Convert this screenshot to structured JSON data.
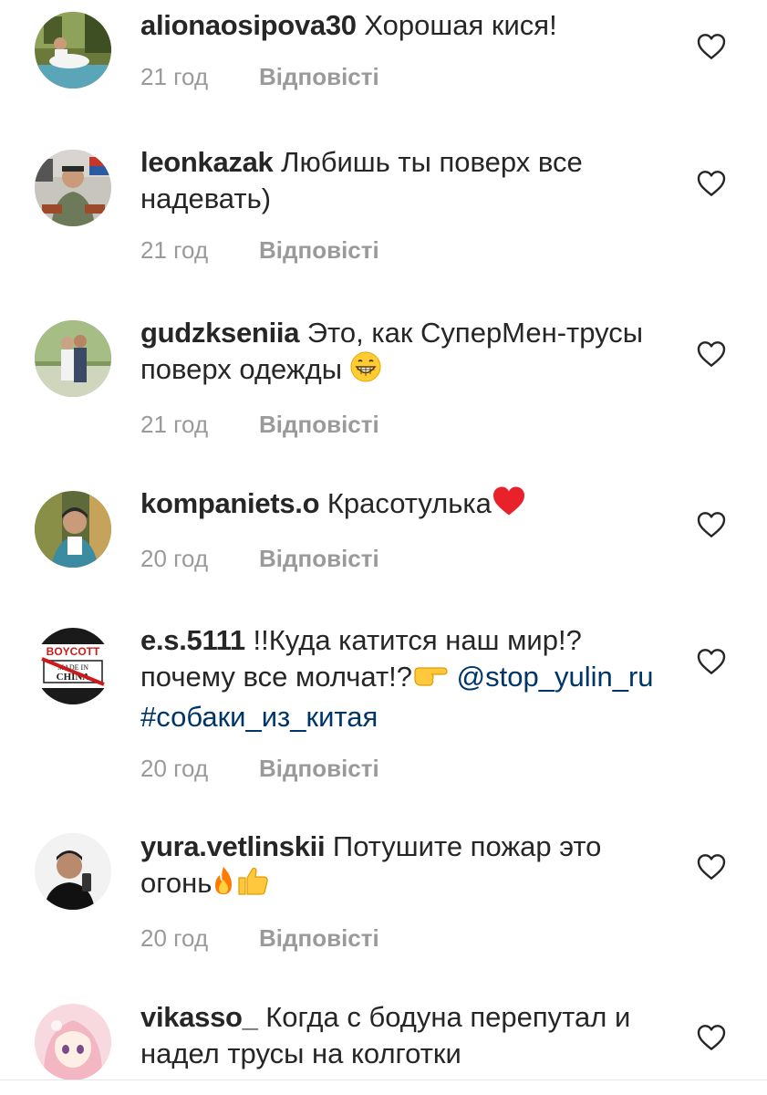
{
  "reply_label": "Відповісті",
  "comments": [
    {
      "username": "alionaosipova30",
      "text": "Хорошая кися!",
      "time": "21 год",
      "avatar": "photo-avatar"
    },
    {
      "username": "leonkazak",
      "text": "Любишь ты поверх все надевать)",
      "time": "21 год",
      "avatar": "photo-avatar"
    },
    {
      "username": "gudzkseniia",
      "text": "Это, как СуперМен-трусы поверх одежды",
      "emoji": "grinning-face-emoji",
      "time": "21 год",
      "avatar": "photo-avatar"
    },
    {
      "username": "kompaniets.o",
      "text": "Красотулька",
      "emoji": "red-heart-emoji",
      "time": "20 год",
      "avatar": "photo-avatar"
    },
    {
      "username": "e.s.5111",
      "text": "!!Куда катится наш мир!?почему все молчат!?",
      "emoji": "pointing-right-emoji",
      "mention": "@stop_yulin_ru",
      "hashtag": "#собаки_из_китая",
      "time": "20 год",
      "avatar": "boycott-made-in-china-avatar",
      "avatar_text_top": "BOYCOTT",
      "avatar_text_mid": "MADE IN",
      "avatar_text_bot": "CHINA"
    },
    {
      "username": "yura.vetlinskii",
      "text": "Потушите пожар это огонь",
      "emoji": "fire-emoji, thumbs-up-emoji",
      "time": "20 год",
      "avatar": "photo-avatar"
    },
    {
      "username": "vikasso_",
      "text": "Когда с бодуна перепутал и надел трусы на колготки",
      "time": "",
      "avatar": "anime-girl-avatar"
    }
  ],
  "colors": {
    "text": "#262626",
    "meta": "#9a9a9a",
    "link": "#003569",
    "heart_outline": "#262626"
  }
}
